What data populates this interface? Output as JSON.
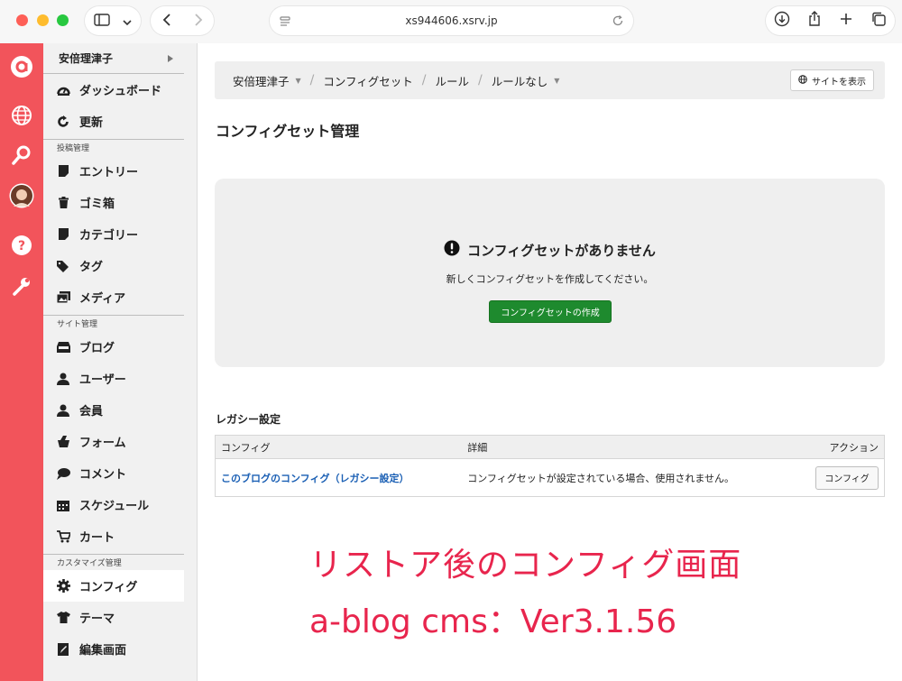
{
  "browser": {
    "url": "xs944606.xsrv.jp"
  },
  "sidebar": {
    "user_name": "安倍理津子",
    "sections": [
      {
        "label": "",
        "items": [
          {
            "label": "ダッシュボード",
            "icon": "dashboard-icon"
          },
          {
            "label": "更新",
            "icon": "refresh-icon"
          }
        ]
      },
      {
        "label": "投稿管理",
        "items": [
          {
            "label": "エントリー",
            "icon": "entry-icon"
          },
          {
            "label": "ゴミ箱",
            "icon": "trash-icon"
          },
          {
            "label": "カテゴリー",
            "icon": "category-icon"
          },
          {
            "label": "タグ",
            "icon": "tag-icon"
          },
          {
            "label": "メディア",
            "icon": "media-icon"
          }
        ]
      },
      {
        "label": "サイト管理",
        "items": [
          {
            "label": "ブログ",
            "icon": "blog-icon"
          },
          {
            "label": "ユーザー",
            "icon": "user-icon"
          },
          {
            "label": "会員",
            "icon": "member-icon"
          },
          {
            "label": "フォーム",
            "icon": "form-icon"
          },
          {
            "label": "コメント",
            "icon": "comment-icon"
          },
          {
            "label": "スケジュール",
            "icon": "calendar-icon"
          },
          {
            "label": "カート",
            "icon": "cart-icon"
          }
        ]
      },
      {
        "label": "カスタマイズ管理",
        "items": [
          {
            "label": "コンフィグ",
            "icon": "gear-icon",
            "active": true
          },
          {
            "label": "テーマ",
            "icon": "tshirt-icon"
          },
          {
            "label": "編集画面",
            "icon": "edit-icon"
          }
        ]
      }
    ]
  },
  "breadcrumb": {
    "items": [
      "安倍理津子",
      "コンフィグセット",
      "ルール",
      "ルールなし"
    ],
    "site_button": "サイトを表示"
  },
  "page": {
    "title": "コンフィグセット管理",
    "empty_title": "コンフィグセットがありません",
    "empty_sub": "新しくコンフィグセットを作成してください。",
    "create_button": "コンフィグセットの作成"
  },
  "legacy": {
    "title": "レガシー設定",
    "headers": [
      "コンフィグ",
      "詳細",
      "アクション"
    ],
    "row": {
      "link": "このブログのコンフィグ（レガシー設定）",
      "detail": "コンフィグセットが設定されている場合、使用されません。",
      "button": "コンフィグ"
    }
  },
  "overlay": {
    "line1": "リストア後のコンフィグ画面",
    "line2": "a-blog cms：Ver3.1.56"
  },
  "colors": {
    "brand_red": "#f2545b",
    "create_green": "#1e8a2e",
    "overlay_text": "#e8254d",
    "link_blue": "#1a5fb4"
  }
}
